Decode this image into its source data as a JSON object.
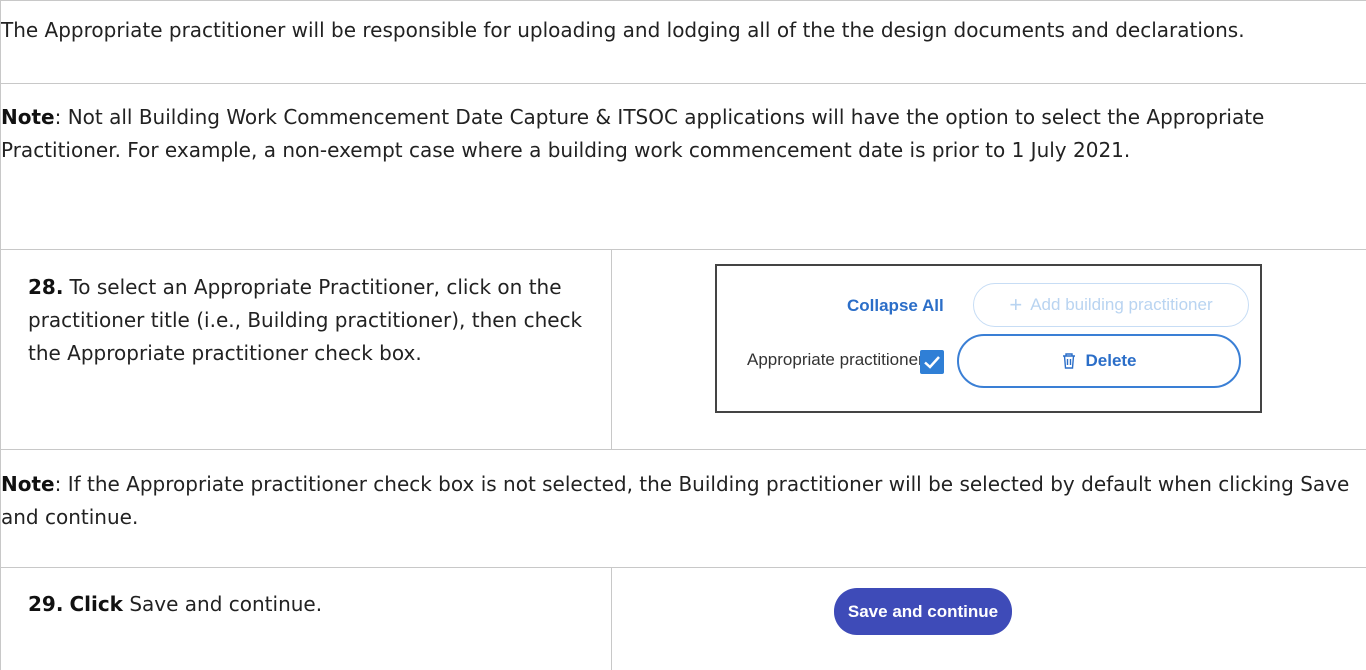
{
  "intro": {
    "text": "The Appropriate practitioner will be responsible for uploading and lodging all of the the design documents and declarations."
  },
  "note1": {
    "label": "Note",
    "text": ":  Not all Building Work Commencement Date Capture & ITSOC applications will have the option to select the Appropriate Practitioner. For example, a non-exempt case where a building work commencement date is prior to 1 July 2021."
  },
  "step28": {
    "number": "28.",
    "text": "To select an Appropriate Practitioner, click on the practitioner title (i.e., Building practitioner), then check the Appropriate practitioner check box.",
    "screenshot": {
      "collapse_label": "Collapse All",
      "add_label": "Add building practitioner",
      "checkbox_label": "Appropriate practitioner",
      "delete_label": "Delete"
    }
  },
  "note2": {
    "label": "Note",
    "text": ":  If the Appropriate practitioner check box is not selected, the Building practitioner will be selected by default when clicking Save and continue."
  },
  "step29": {
    "number": "29.",
    "action": "Click",
    "text": "Save and continue.",
    "button_label": "Save and continue"
  },
  "colors": {
    "link": "#2b6ec8",
    "checkbox": "#2f7fd6",
    "save_button": "#3e4bb8",
    "border": "#c8c8c8"
  }
}
